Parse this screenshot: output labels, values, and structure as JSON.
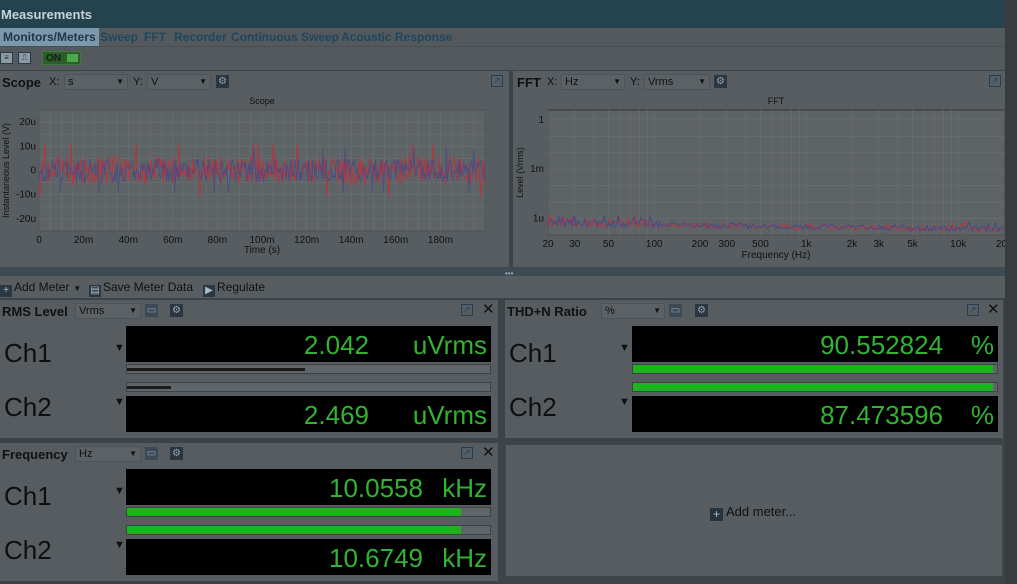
{
  "app": {
    "title": "Measurements"
  },
  "tabs": [
    "Monitors/Meters",
    "Sweep",
    "FFT",
    "Recorder",
    "Continuous Sweep",
    "Acoustic Response"
  ],
  "toolbar": {
    "on_label": "ON"
  },
  "scope": {
    "title": "Scope",
    "x_label": "X:",
    "x_unit": "s",
    "y_label": "Y:",
    "y_unit": "V",
    "chart_title": "Scope"
  },
  "fft": {
    "title": "FFT",
    "x_label": "X:",
    "x_unit": "Hz",
    "y_label": "Y:",
    "y_unit": "Vrms",
    "chart_title": "FFT"
  },
  "chart_data": [
    {
      "type": "line",
      "title": "Scope",
      "xlabel": "Time (s)",
      "ylabel": "Instantaneous Level (V)",
      "xlim": [
        0,
        0.2
      ],
      "ylim": [
        -25,
        25
      ],
      "x_ticks": [
        "0",
        "20m",
        "40m",
        "60m",
        "80m",
        "100m",
        "120m",
        "140m",
        "160m",
        "180m"
      ],
      "y_ticks": [
        "20u",
        "10u",
        "0",
        "-10u",
        "-20u"
      ],
      "series": [
        {
          "color": "#c0303a",
          "amplitude_u": [
            -6,
            6
          ],
          "peak_u": 11
        },
        {
          "color": "#404a8c",
          "amplitude_u": [
            -5,
            5
          ],
          "peak_u": 9
        }
      ],
      "grid": true
    },
    {
      "type": "line",
      "title": "FFT",
      "xlabel": "Frequency (Hz)",
      "ylabel": "Level (Vrms)",
      "x_scale": "log",
      "y_scale": "log",
      "x_ticks": [
        "20",
        "30",
        "50",
        "100",
        "200",
        "300",
        "500",
        "1k",
        "2k",
        "3k",
        "5k",
        "10k",
        "20k"
      ],
      "y_ticks": [
        "1",
        "1m",
        "1u"
      ],
      "series": [
        {
          "color": "#c0303a",
          "level_range": "noise floor near 1u"
        },
        {
          "color": "#404a8c",
          "level_range": "noise floor near 1u"
        }
      ],
      "grid": true
    }
  ],
  "meter_toolbar": {
    "add_meter": "Add Meter",
    "save_meter_data": "Save Meter Data",
    "regulate": "Regulate"
  },
  "meters": {
    "rms": {
      "title": "RMS Level",
      "unit_select": "Vrms",
      "channels": [
        {
          "label": "Ch1",
          "value": "2.042",
          "unit": "uVrms",
          "bar_fraction": 0.49
        },
        {
          "label": "Ch2",
          "value": "2.469",
          "unit": "uVrms",
          "bar_fraction": 0.12
        }
      ]
    },
    "thdn": {
      "title": "THD+N Ratio",
      "unit_select": "%",
      "channels": [
        {
          "label": "Ch1",
          "value": "90.552824",
          "unit": "%",
          "bar_fraction": 0.99
        },
        {
          "label": "Ch2",
          "value": "87.473596",
          "unit": "%",
          "bar_fraction": 0.99
        }
      ]
    },
    "freq": {
      "title": "Frequency",
      "unit_select": "Hz",
      "channels": [
        {
          "label": "Ch1",
          "value": "10.0558",
          "unit": "kHz",
          "bar_fraction": 0.92
        },
        {
          "label": "Ch2",
          "value": "10.6749",
          "unit": "kHz",
          "bar_fraction": 0.92
        }
      ]
    },
    "add_meter_placeholder": "Add meter..."
  },
  "colors": {
    "meter_green": "#33b233",
    "bar_green": "#1db31d",
    "bar_dark": "#1a1a1a",
    "trace_red": "#c0303a",
    "trace_blue": "#404a8c"
  },
  "icons": {
    "gear": "gear-icon",
    "popout": "popout-icon",
    "close": "close-icon",
    "plus": "plus-icon",
    "save": "save-icon",
    "regulate": "play-icon"
  }
}
